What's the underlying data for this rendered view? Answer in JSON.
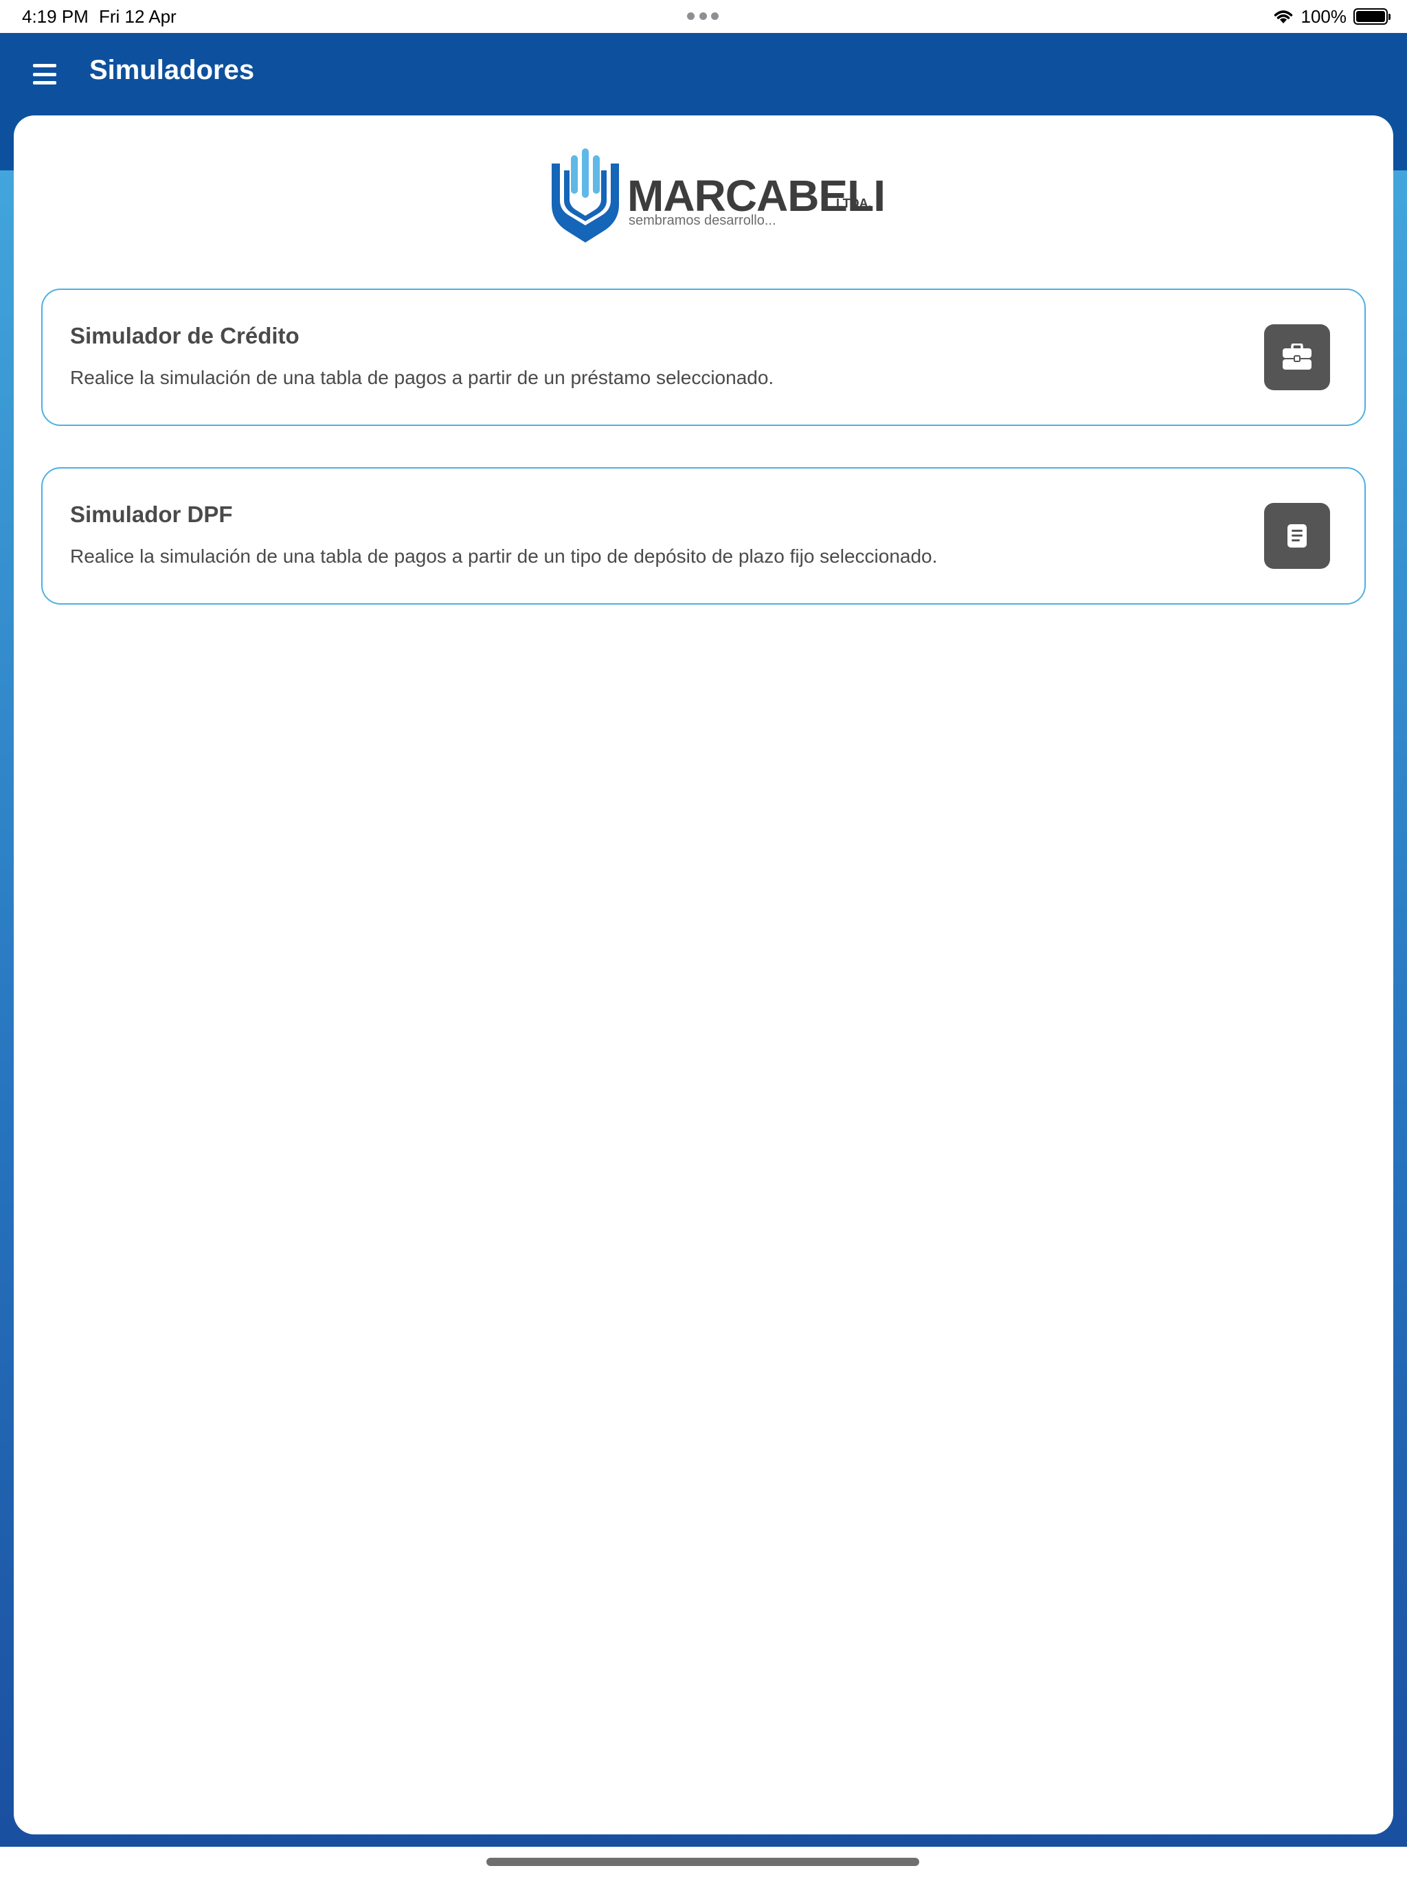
{
  "status_bar": {
    "time": "4:19 PM",
    "date": "Fri 12 Apr",
    "battery": "100%"
  },
  "toolbar": {
    "title": "Simuladores"
  },
  "logo": {
    "name": "MARCABELI",
    "suffix": "LTDA.",
    "tagline": "sembramos desarrollo..."
  },
  "simulators": [
    {
      "title": "Simulador de Crédito",
      "description": "Realice la simulación de una tabla de pagos a partir de un préstamo seleccionado.",
      "icon": "briefcase-icon"
    },
    {
      "title": "Simulador DPF",
      "description": "Realice la simulación de una tabla de pagos a partir de un tipo de depósito de plazo fijo seleccionado.",
      "icon": "document-icon"
    }
  ],
  "colors": {
    "toolbar": "#0d519e",
    "gradient_top": "#42a5db",
    "gradient_bottom": "#1a4f9f",
    "card_border": "#4cb0e4",
    "icon_button": "#555555",
    "logo_blue": "#1565b8",
    "logo_light_blue": "#5fb8e6"
  }
}
